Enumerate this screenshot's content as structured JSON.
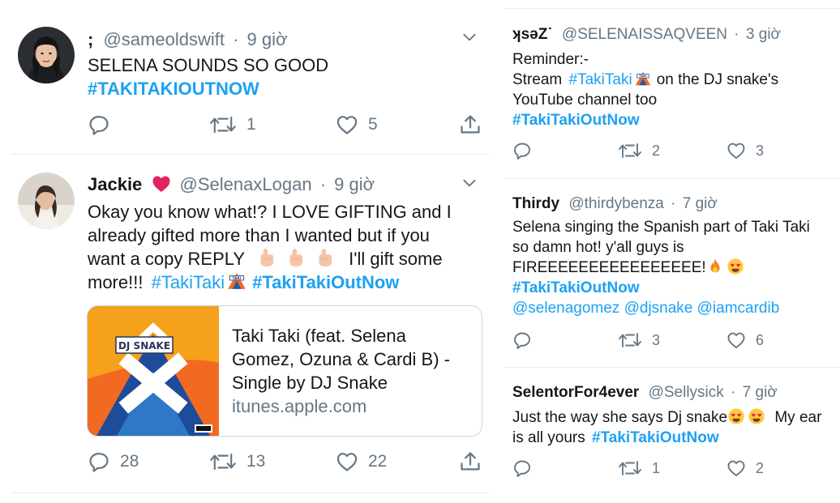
{
  "left": {
    "tweets": [
      {
        "name": ";",
        "handle": "@sameoldswift",
        "dot": "·",
        "time": "9 giờ",
        "lines": [
          "SELENA SOUNDS SO GOOD"
        ],
        "hashtag": "#TAKITAKIOUTNOW",
        "replies": "",
        "retweets": "1",
        "likes": "5"
      },
      {
        "name": "Jackie",
        "handle": "@SelenaxLogan",
        "dot": "·",
        "time": "9 giờ",
        "lines": [
          "Okay you know what!? I LOVE GIFTING and I",
          "already gifted more than I wanted but if you",
          "want a copy REPLY",
          "I'll gift some",
          "more!!!"
        ],
        "hashtags": [
          "#TakiTaki",
          "#TakiTakiOutNow"
        ],
        "card": {
          "title_lines": [
            "Taki Taki (feat. Selena",
            "Gomez, Ozuna & Cardi B) -",
            "Single by DJ Snake"
          ],
          "domain": "itunes.apple.com",
          "art_text": "DJ SNAKE"
        },
        "replies": "28",
        "retweets": "13",
        "likes": "22"
      }
    ]
  },
  "right": {
    "tweets": [
      {
        "name": "ʞsəZ˙",
        "handle": "@SELENAISSAQVEEN",
        "dot": "·",
        "time": "3 giờ",
        "lines": [
          "Reminder:-",
          "Stream",
          "on the DJ snake's",
          "YouTube channel too"
        ],
        "hashtags": [
          "#TakiTaki",
          "#TakiTakiOutNow"
        ],
        "replies": "",
        "retweets": "2",
        "likes": "3"
      },
      {
        "name": "Thirdy",
        "handle": "@thirdybenza",
        "dot": "·",
        "time": "7 giờ",
        "lines": [
          "Selena singing the Spanish part of Taki Taki",
          "so damn hot! y'all guys is",
          "FIREEEEEEEEEEEEEEEE!"
        ],
        "hashtag": "#TakiTakiOutNow",
        "mentions": "@selenagomez @djsnake @iamcardib",
        "replies": "",
        "retweets": "3",
        "likes": "6"
      },
      {
        "name": "SelentorFor4ever",
        "handle": "@Sellysick",
        "dot": "·",
        "time": "7 giờ",
        "lines": [
          "Just the way she says Dj snake",
          "My ear",
          "is all yours"
        ],
        "hashtag": "#TakiTakiOutNow",
        "replies": "",
        "retweets": "1",
        "likes": "2"
      }
    ]
  },
  "colors": {
    "link": "#1da1f2",
    "muted": "#657786",
    "heart": "#e0245e",
    "border": "#e6ecf0"
  },
  "icons": [
    "reply-icon",
    "retweet-icon",
    "like-icon",
    "share-icon",
    "chevron-down-icon",
    "red-heart-emoji",
    "pointing-hand-emoji",
    "fire-emoji",
    "heart-eyes-emoji",
    "taki-taki-emoji"
  ]
}
